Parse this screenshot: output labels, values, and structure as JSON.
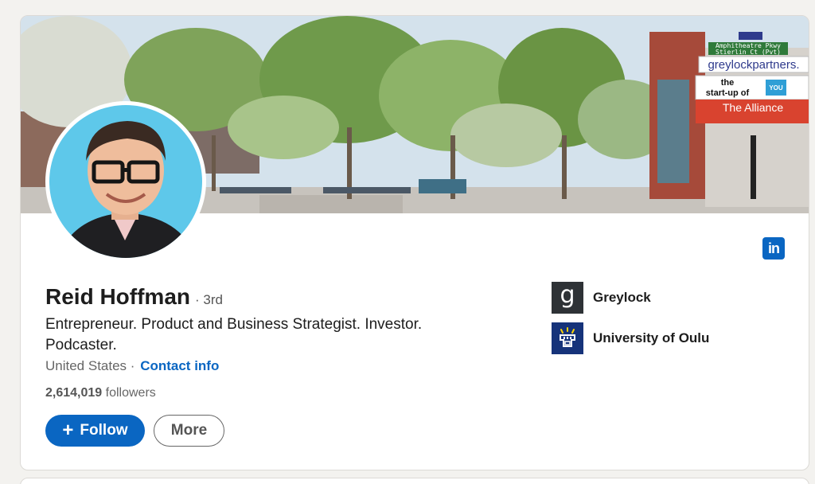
{
  "profile": {
    "name": "Reid Hoffman",
    "degree": "· 3rd",
    "headline": "Entrepreneur. Product and Business Strategist. Investor. Podcaster.",
    "location": "United States ·",
    "contact_label": "Contact info",
    "followers_count": "2,614,019",
    "followers_label": "followers"
  },
  "actions": {
    "follow_plus": "+",
    "follow_label": "Follow",
    "more_label": "More"
  },
  "organizations": [
    {
      "name": "Greylock",
      "logo_glyph": "g",
      "icon": "greylock-logo"
    },
    {
      "name": "University of Oulu",
      "icon": "university-of-oulu-logo"
    }
  ],
  "banner": {
    "street_sign": "Amphitheatre Pkwy",
    "street_sign_2": "Stierlin Ct (Pvt)",
    "billboard_1": "greylockpartners.",
    "billboard_2a": "the",
    "billboard_2b": "start-up of",
    "billboard_you": "YOU",
    "billboard_3": "The Alliance"
  },
  "linkedin_badge": "in",
  "colors": {
    "accent": "#0a66c2",
    "greylock": "#2e3236",
    "oulu": "#16337a"
  }
}
